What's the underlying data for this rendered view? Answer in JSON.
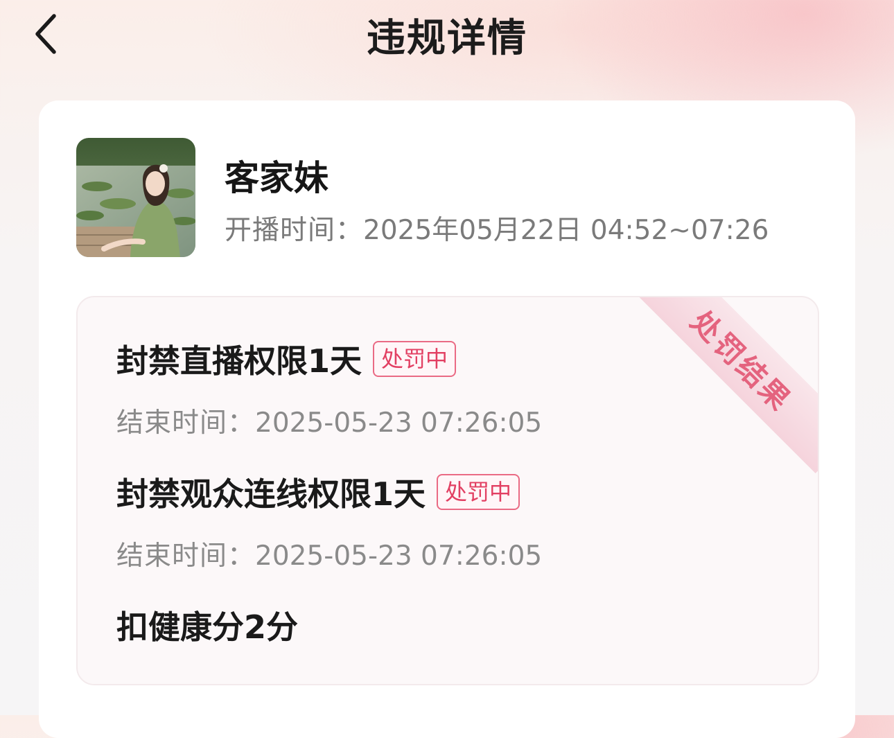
{
  "header": {
    "title": "违规详情",
    "back_icon": "chevron-left-icon"
  },
  "streamer": {
    "name": "客家妹",
    "time_label": "开播时间：",
    "time_value": "2025年05月22日 04:52~07:26"
  },
  "result": {
    "ribbon_label": "处罚结果",
    "penalties": [
      {
        "title": "封禁直播权限1天",
        "status": "处罚中",
        "end_label": "结束时间：",
        "end_value": "2025-05-23 07:26:05"
      },
      {
        "title": "封禁观众连线权限1天",
        "status": "处罚中",
        "end_label": "结束时间：",
        "end_value": "2025-05-23 07:26:05"
      }
    ],
    "health_deduction": "扣健康分2分"
  },
  "colors": {
    "accent": "#e23f62",
    "ribbon_text": "#e4637e",
    "secondary_text": "#7a7a7a"
  }
}
